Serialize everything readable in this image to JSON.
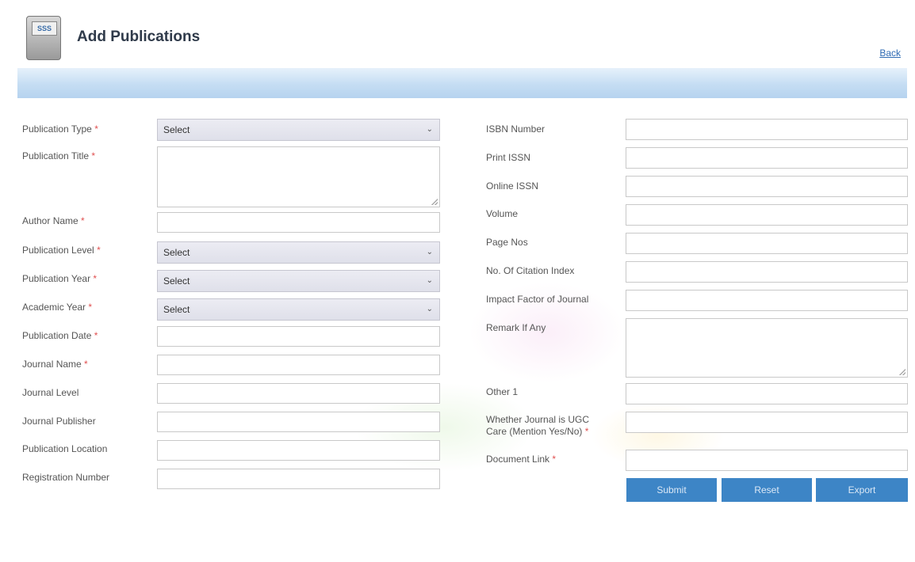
{
  "header": {
    "title": "Add Publications",
    "icon_text": "SSS",
    "back_label": "Back"
  },
  "form": {
    "left": {
      "publication_type": {
        "label": "Publication Type",
        "required": "*",
        "value": "Select"
      },
      "publication_title": {
        "label": "Publication Title",
        "required": "*",
        "value": ""
      },
      "author_name": {
        "label": "Author Name",
        "required": "*",
        "value": ""
      },
      "publication_level": {
        "label": "Publication Level",
        "required": "*",
        "value": "Select"
      },
      "publication_year": {
        "label": "Publication Year",
        "required": "*",
        "value": "Select"
      },
      "academic_year": {
        "label": "Academic Year",
        "required": "*",
        "value": "Select"
      },
      "publication_date": {
        "label": "Publication Date",
        "required": "*",
        "value": ""
      },
      "journal_name": {
        "label": "Journal Name",
        "required": "*",
        "value": ""
      },
      "journal_level": {
        "label": "Journal Level",
        "value": ""
      },
      "journal_publisher": {
        "label": "Journal Publisher",
        "value": ""
      },
      "publication_location": {
        "label": "Publication Location",
        "value": ""
      },
      "registration_number": {
        "label": "Registration Number",
        "value": ""
      }
    },
    "right": {
      "isbn_number": {
        "label": "ISBN Number",
        "value": ""
      },
      "print_issn": {
        "label": "Print ISSN",
        "value": ""
      },
      "online_issn": {
        "label": "Online ISSN",
        "value": ""
      },
      "volume": {
        "label": "Volume",
        "value": ""
      },
      "page_nos": {
        "label": "Page Nos",
        "value": ""
      },
      "citation_index": {
        "label": "No. Of Citation Index",
        "value": ""
      },
      "impact_factor": {
        "label": "Impact Factor of Journal",
        "value": ""
      },
      "remark": {
        "label": "Remark If Any",
        "value": ""
      },
      "other1": {
        "label": "Other 1",
        "value": ""
      },
      "ugc_care": {
        "label_line1": "Whether Journal is UGC",
        "label_line2": "Care (Mention Yes/No)",
        "required": "*",
        "value": ""
      },
      "document_link": {
        "label": "Document Link",
        "required": "*",
        "value": ""
      }
    }
  },
  "buttons": {
    "submit": "Submit",
    "reset": "Reset",
    "export": "Export"
  },
  "colors": {
    "accent_button": "#3d85c6",
    "header_bar": "#c5ddf3",
    "required_mark": "#e05050"
  }
}
